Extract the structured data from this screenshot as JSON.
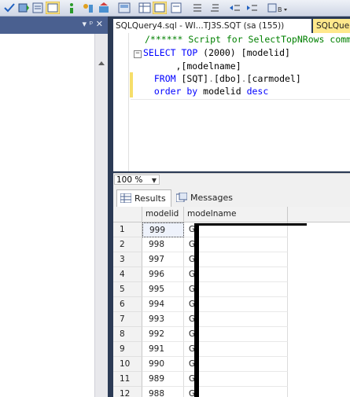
{
  "editor_tab": {
    "active_title": "SQLQuery4.sql - WI...TJ3S.SQT (sa (155))",
    "inactive_title": "SQLQue"
  },
  "left_panel": {
    "header_controls": "▾ ᵖ ✕"
  },
  "editor": {
    "lines": [
      {
        "text": "/****** Script for SelectTopNRows command"
      },
      {
        "p1": "SELECT",
        "p2": " TOP ",
        "p3": "(2000)",
        "p4": " [modelid]"
      },
      {
        "text": "      ,[modelname]"
      },
      {
        "p1": "  FROM",
        "p2": " [SQT]",
        "p3": ".",
        "p4": "[dbo]",
        "p5": ".",
        "p6": "[carmodel]"
      },
      {
        "p1": "  order by",
        "p2": " modelid ",
        "p3": "desc"
      }
    ],
    "collapse_symbol": "−"
  },
  "zoom": {
    "value": "100 %"
  },
  "results_tabs": {
    "results_label": "Results",
    "messages_label": "Messages"
  },
  "grid": {
    "columns": [
      "modelid",
      "modelname"
    ],
    "rows": [
      {
        "n": "1",
        "id": "999",
        "name": "G"
      },
      {
        "n": "2",
        "id": "998",
        "name": "G"
      },
      {
        "n": "3",
        "id": "997",
        "name": "G"
      },
      {
        "n": "4",
        "id": "996",
        "name": "G"
      },
      {
        "n": "5",
        "id": "995",
        "name": "G"
      },
      {
        "n": "6",
        "id": "994",
        "name": "G"
      },
      {
        "n": "7",
        "id": "993",
        "name": "G"
      },
      {
        "n": "8",
        "id": "992",
        "name": "G"
      },
      {
        "n": "9",
        "id": "991",
        "name": "G"
      },
      {
        "n": "10",
        "id": "990",
        "name": "G"
      },
      {
        "n": "11",
        "id": "989",
        "name": "G"
      },
      {
        "n": "12",
        "id": "988",
        "name": "G"
      }
    ]
  },
  "colors": {
    "keyword": "#0000ff",
    "comment": "#008000",
    "gray": "#808080",
    "highlight_tab": "#ffe88c",
    "frame": "#2b3a55"
  }
}
